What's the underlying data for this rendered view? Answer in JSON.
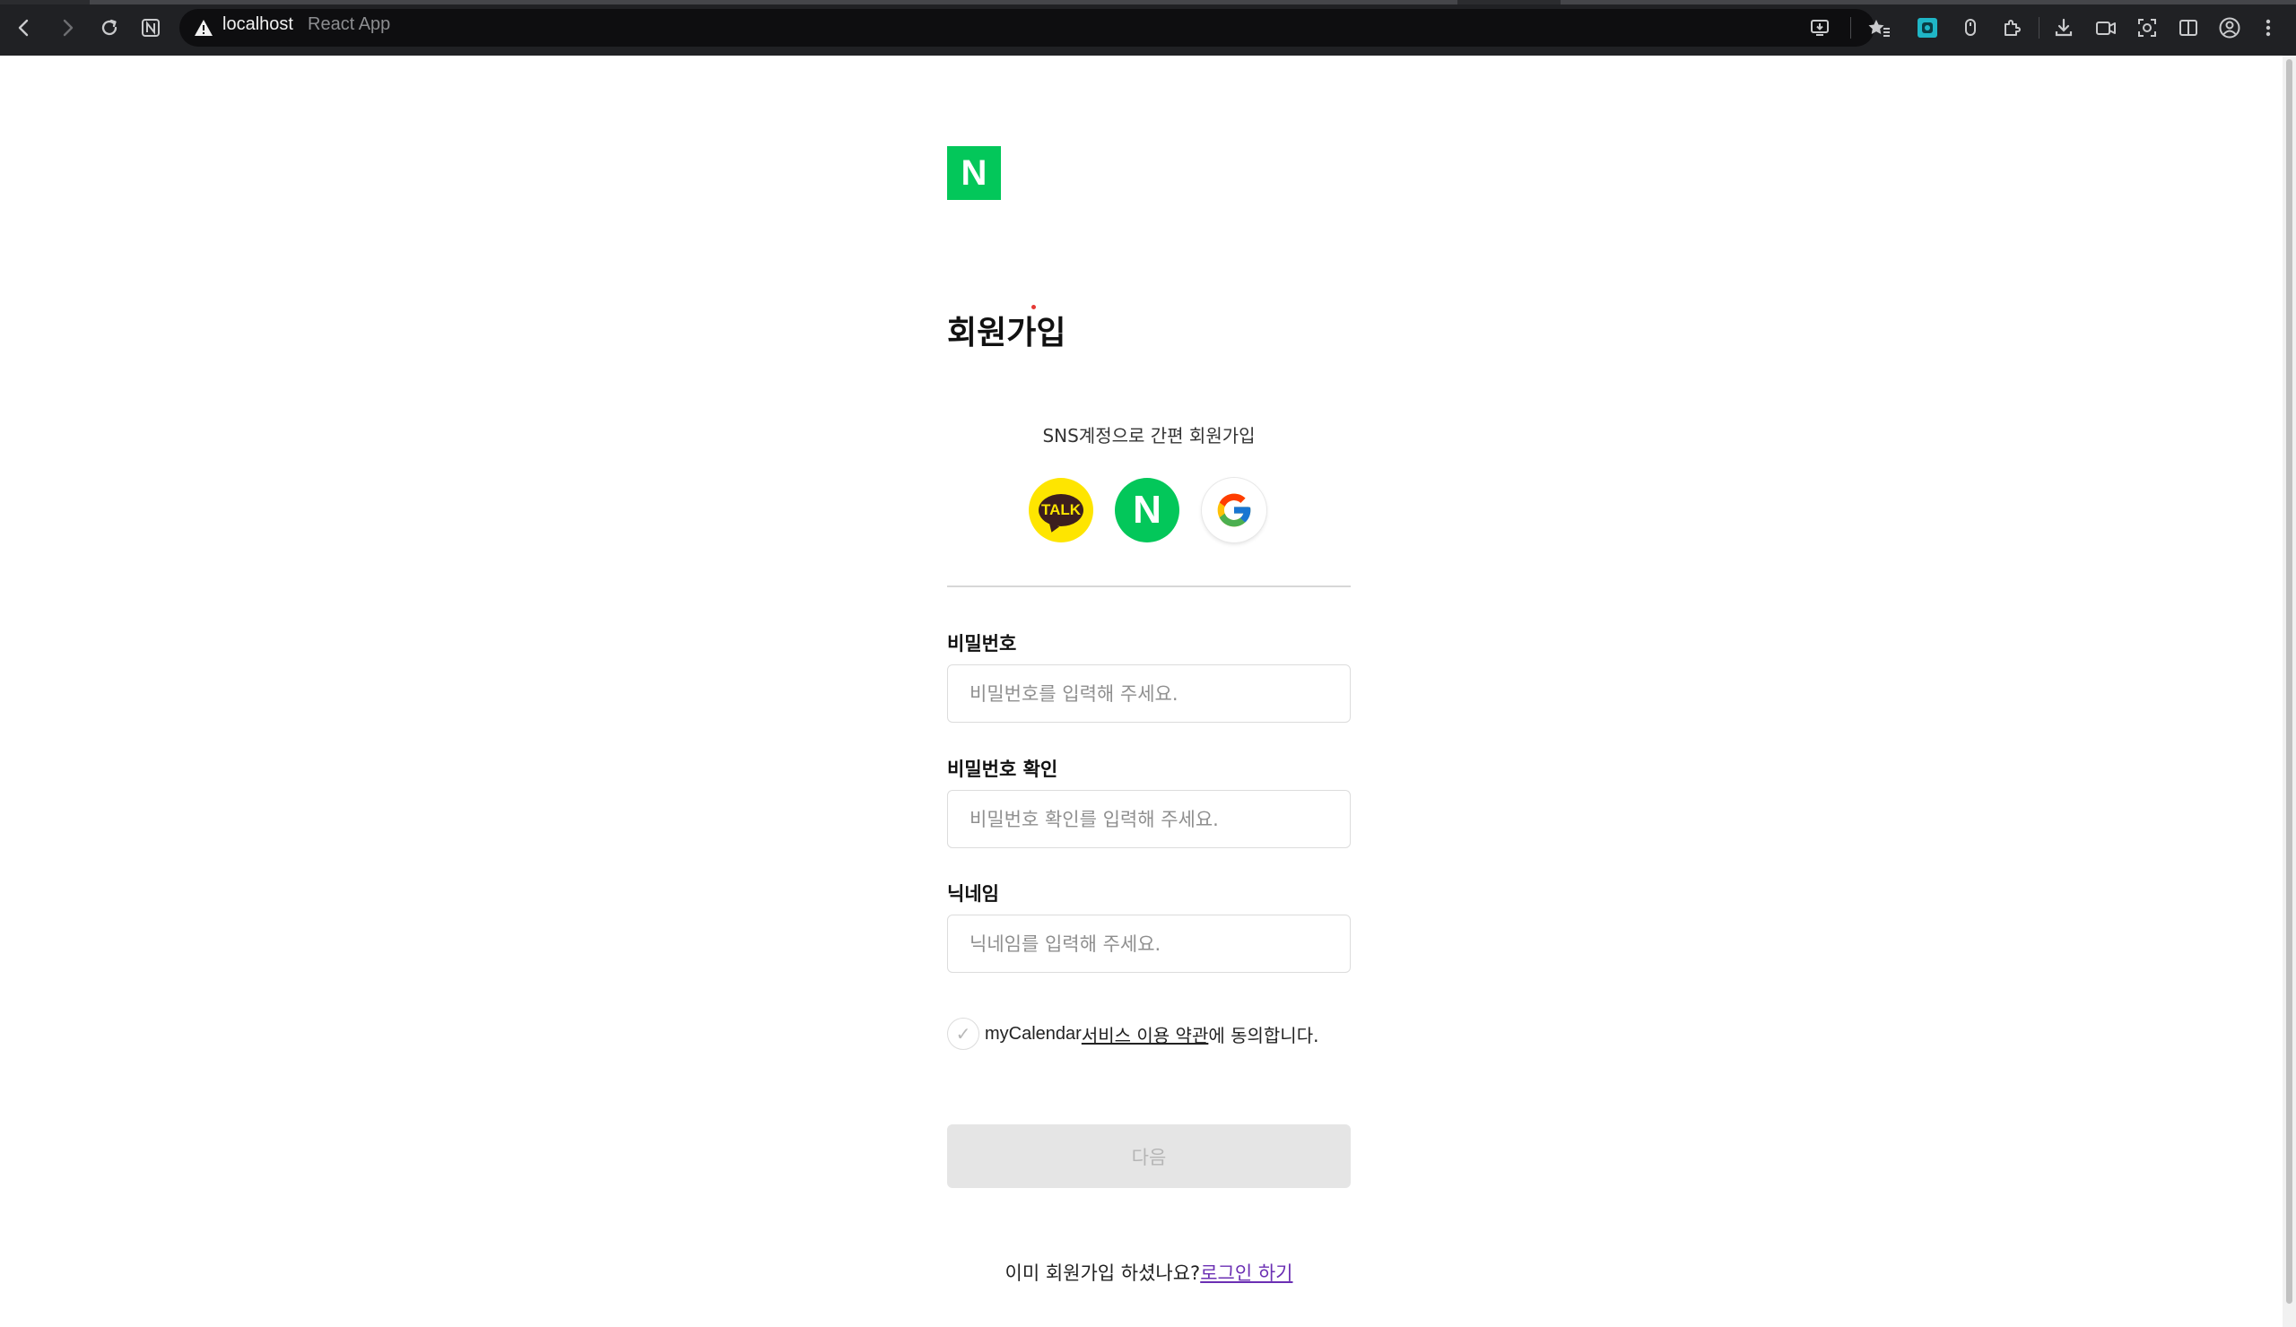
{
  "browser": {
    "host": "localhost",
    "tab_title": "React App"
  },
  "page": {
    "logo_letter": "N",
    "title": "회원가입",
    "sns_caption": "SNS계정으로 간편 회원가입",
    "sns": {
      "kakao_label": "TALK",
      "naver_label": "N",
      "google_label": "G"
    },
    "fields": {
      "password": {
        "label": "비밀번호",
        "placeholder": "비밀번호를 입력해 주세요."
      },
      "password_confirm": {
        "label": "비밀번호 확인",
        "placeholder": "비밀번호 확인를 입력해 주세요."
      },
      "nickname": {
        "label": "닉네임",
        "placeholder": "닉네임를 입력해 주세요."
      }
    },
    "agreement": {
      "brand": "myCalendar",
      "terms_link": "서비스 이용 약관",
      "suffix": "에 동의합니다.",
      "checkmark": "✓"
    },
    "next_button": "다음",
    "login_prompt": "이미 회원가입 하셨나요?",
    "login_link": "로그인 하기"
  },
  "colors": {
    "brand_green": "#03c75a",
    "kakao_yellow": "#fee500",
    "disabled_button": "#e5e5e5",
    "link_purple": "#6b2fb3"
  }
}
